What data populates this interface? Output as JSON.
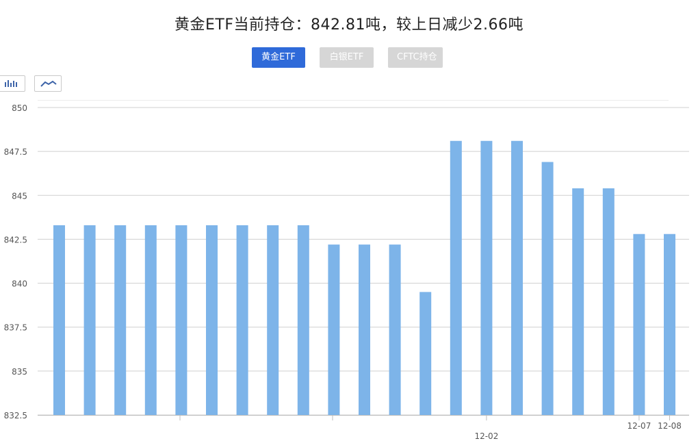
{
  "title": "黄金ETF当前持仓：842.81吨，较上日减少2.66吨",
  "tabs": [
    {
      "label": "黄金ETF",
      "active": true
    },
    {
      "label": "白银ETF",
      "active": false
    },
    {
      "label": "CFTC持仓",
      "active": false
    }
  ],
  "toggles": [
    {
      "name": "bar-chart-icon"
    },
    {
      "name": "line-chart-icon"
    }
  ],
  "colors": {
    "bar": "#7db4e9",
    "tab_active": "#2f6ad9",
    "tab_inactive": "#d6d6d6",
    "grid": "#cfcfcf",
    "text": "#555555"
  },
  "chart_data": {
    "type": "bar",
    "ylim": [
      832.5,
      850
    ],
    "yticks": [
      "832.5",
      "835",
      "837.5",
      "840",
      "842.5",
      "845",
      "847.5",
      "850"
    ],
    "grid": true,
    "values": [
      843.3,
      843.3,
      843.3,
      843.3,
      843.3,
      843.3,
      843.3,
      843.3,
      843.3,
      842.2,
      842.2,
      842.2,
      839.5,
      848.1,
      848.1,
      848.1,
      846.9,
      845.4,
      845.4,
      842.8,
      842.8
    ],
    "xtick_labels": [
      {
        "index": 14,
        "label": "12-02"
      },
      {
        "index": 19,
        "label": "12-07"
      },
      {
        "index": 20,
        "label": "12-08"
      }
    ]
  }
}
